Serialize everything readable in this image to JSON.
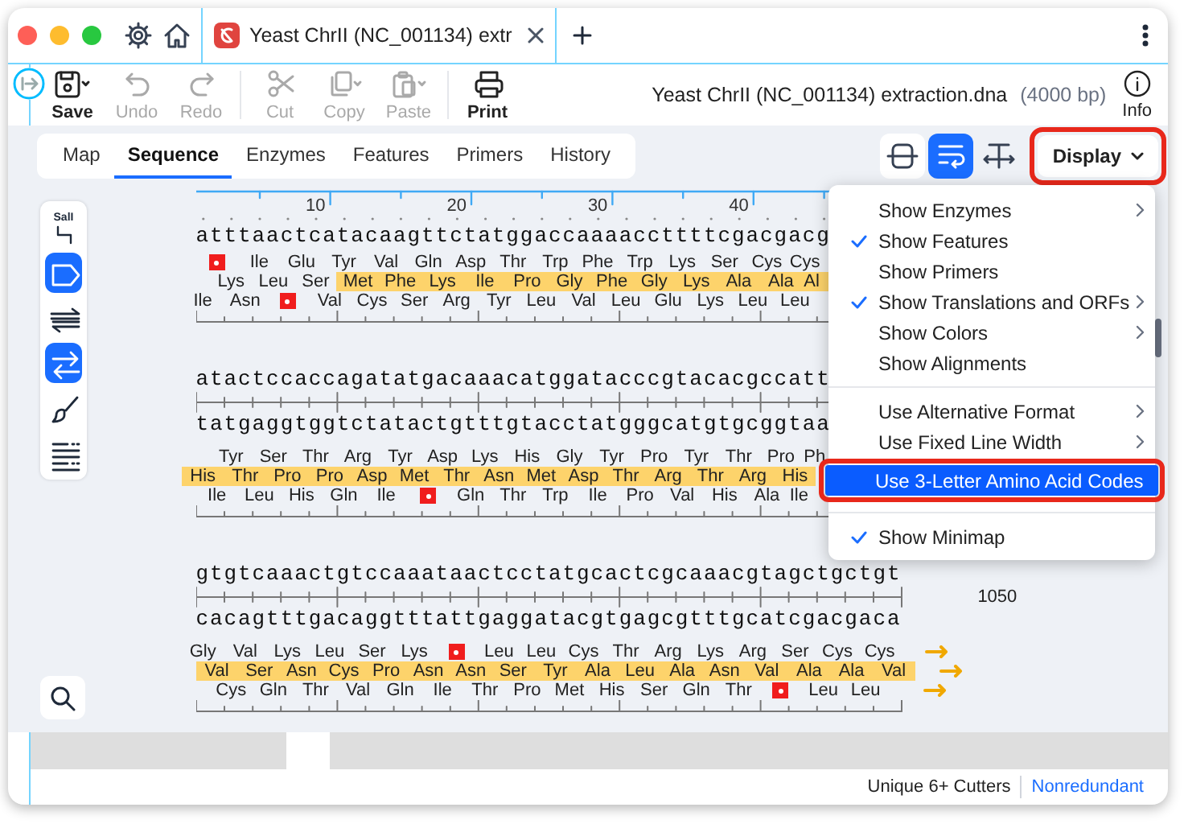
{
  "tab": {
    "title": "Yeast ChrII (NC_001134) extr",
    "selected": true
  },
  "toolbar": [
    [
      {
        "kind": "save",
        "label": "Save",
        "disabled": false
      },
      {
        "kind": "undo",
        "label": "Undo",
        "disabled": true
      },
      {
        "kind": "redo",
        "label": "Redo",
        "disabled": true
      }
    ],
    [
      {
        "kind": "cut",
        "label": "Cut",
        "disabled": true
      },
      {
        "kind": "copy",
        "label": "Copy",
        "disabled": true
      },
      {
        "kind": "paste",
        "label": "Paste",
        "disabled": true
      }
    ],
    [
      {
        "kind": "print",
        "label": "Print",
        "disabled": false
      }
    ]
  ],
  "document": {
    "title": "Yeast ChrII (NC_001134) extraction.dna",
    "length": "(4000 bp)"
  },
  "info": {
    "label": "Info"
  },
  "view_tabs": [
    {
      "label": "Map",
      "selected": false
    },
    {
      "label": "Sequence",
      "selected": true
    },
    {
      "label": "Enzymes",
      "selected": false
    },
    {
      "label": "Features",
      "selected": false
    },
    {
      "label": "Primers",
      "selected": false
    },
    {
      "label": "History",
      "selected": false
    }
  ],
  "view_buttons": [
    {
      "kind": "minimap",
      "selected": false
    },
    {
      "kind": "wrap",
      "selected": true
    },
    {
      "kind": "fit",
      "selected": false
    }
  ],
  "display_button": {
    "label": "Display",
    "highlighted": true
  },
  "display_menu": {
    "groups": [
      {
        "items": [
          {
            "label": "Show Enzymes",
            "checked": false,
            "submenu": true,
            "selected": false,
            "highlighted": false
          },
          {
            "label": "Show Features",
            "checked": true,
            "submenu": false,
            "selected": false,
            "highlighted": false
          },
          {
            "label": "Show Primers",
            "checked": false,
            "submenu": false,
            "selected": false,
            "highlighted": false
          },
          {
            "label": "Show Translations and ORFs",
            "checked": true,
            "submenu": true,
            "selected": false,
            "highlighted": false
          },
          {
            "label": "Show Colors",
            "checked": false,
            "submenu": true,
            "selected": false,
            "highlighted": false
          },
          {
            "label": "Show Alignments",
            "checked": false,
            "submenu": false,
            "selected": false,
            "highlighted": false
          }
        ]
      },
      {
        "items": [
          {
            "label": "Use Alternative Format",
            "checked": false,
            "submenu": true,
            "selected": false,
            "highlighted": false
          },
          {
            "label": "Use Fixed Line Width",
            "checked": false,
            "submenu": true,
            "selected": false,
            "highlighted": false
          },
          {
            "label": "Use 3-Letter Amino Acid Codes",
            "checked": false,
            "submenu": false,
            "selected": true,
            "highlighted": true
          }
        ]
      },
      {
        "items": [
          {
            "label": "Show Minimap",
            "checked": true,
            "submenu": false,
            "selected": false,
            "highlighted": false
          }
        ]
      }
    ]
  },
  "tools": [
    {
      "kind": "enzyme",
      "label": "SalI",
      "selected": false
    },
    {
      "kind": "feature",
      "selected": true
    },
    {
      "kind": "strands",
      "selected": false
    },
    {
      "kind": "translate",
      "selected": true
    },
    {
      "kind": "brush",
      "selected": false
    },
    {
      "kind": "list",
      "selected": false
    }
  ],
  "sequence": {
    "blocks": [
      {
        "ruler": [
          "10",
          "20",
          "30",
          "40"
        ],
        "forward": "atttaactcatacaagttctatggaccaaaaccttttcgacgacg",
        "translations": [
          {
            "segments": [
              {
                "highlighted": false,
                "codons": [
                  {
                    "kind": "stop"
                  },
                  "Ile",
                  "Glu",
                  "Tyr",
                  "Val",
                  "Gln",
                  "Asp",
                  "Thr",
                  "Trp",
                  "Phe",
                  "Trp",
                  "Lys",
                  "Ser",
                  "Cys",
                  "Cys"
                ]
              }
            ]
          },
          {
            "segments": [
              {
                "highlighted": false,
                "codons": [
                  "Lys",
                  "Leu",
                  "Ser"
                ]
              },
              {
                "highlighted": true,
                "codons": [
                  "Met",
                  "Phe",
                  "Lys",
                  "Ile",
                  "Pro",
                  "Gly",
                  "Phe",
                  "Gly",
                  "Lys",
                  "Ala",
                  "Ala",
                  "Al"
                ]
              }
            ]
          },
          {
            "segments": [
              {
                "highlighted": false,
                "codons": [
                  "Ile",
                  "Asn",
                  {
                    "kind": "stop"
                  },
                  "Val",
                  "Cys",
                  "Ser",
                  "Arg",
                  "Tyr",
                  "Leu",
                  "Val",
                  "Leu",
                  "Glu",
                  "Lys",
                  "Leu",
                  "Leu"
                ]
              }
            ]
          }
        ]
      },
      {
        "forward": "atactccaccagatatgacaaacatggatacccgtacacgccatt",
        "complement": "tatgaggtggtctatactgtttgtacctatgggcatgtgcggtaa",
        "translations": [
          {
            "segments": [
              {
                "highlighted": false,
                "codons": [
                  "Tyr",
                  "Ser",
                  "Thr",
                  "Arg",
                  "Tyr",
                  "Asp",
                  "Lys",
                  "His",
                  "Gly",
                  "Tyr",
                  "Pro",
                  "Tyr",
                  "Thr",
                  "Pro",
                  "Ph"
                ]
              }
            ]
          },
          {
            "segments": [
              {
                "highlighted": true,
                "codons": [
                  "His",
                  "Thr",
                  "Pro",
                  "Pro",
                  "Asp",
                  "Met",
                  "Thr",
                  "Asn",
                  "Met",
                  "Asp",
                  "Thr",
                  "Arg",
                  "Thr",
                  "Arg",
                  "His"
                ]
              }
            ]
          },
          {
            "segments": [
              {
                "highlighted": false,
                "codons": [
                  "Ile",
                  "Leu",
                  "His",
                  "Gln",
                  "Ile",
                  {
                    "kind": "stop"
                  },
                  "Gln",
                  "Thr",
                  "Trp",
                  "Ile",
                  "Pro",
                  "Val",
                  "His",
                  "Ala",
                  "Ile"
                ]
              }
            ]
          }
        ]
      },
      {
        "forward": "gtgtcaaactgtccaaataactcctatgcactcgcaaacgtagctgctgt",
        "complement": "cacagtttgacaggtttattgaggatacgtgagcgtttgcatcgacgaca",
        "end_label": "1050",
        "translations": [
          {
            "continues": true,
            "segments": [
              {
                "highlighted": false,
                "codons": [
                  "Gly",
                  "Val",
                  "Lys",
                  "Leu",
                  "Ser",
                  "Lys",
                  {
                    "kind": "stop"
                  },
                  "Leu",
                  "Leu",
                  "Cys",
                  "Thr",
                  "Arg",
                  "Lys",
                  "Arg",
                  "Ser",
                  "Cys",
                  "Cys"
                ]
              }
            ]
          },
          {
            "continues": true,
            "segments": [
              {
                "highlighted": true,
                "codons": [
                  "Val",
                  "Ser",
                  "Asn",
                  "Cys",
                  "Pro",
                  "Asn",
                  "Asn",
                  "Ser",
                  "Tyr",
                  "Ala",
                  "Leu",
                  "Ala",
                  "Asn",
                  "Val",
                  "Ala",
                  "Ala",
                  "Val"
                ]
              }
            ]
          },
          {
            "continues": true,
            "segments": [
              {
                "highlighted": false,
                "codons": [
                  "Cys",
                  "Gln",
                  "Thr",
                  "Val",
                  "Gln",
                  "Ile",
                  "Thr",
                  "Pro",
                  "Met",
                  "His",
                  "Ser",
                  "Gln",
                  "Thr",
                  {
                    "kind": "stop"
                  },
                  "Leu",
                  "Leu"
                ]
              }
            ]
          }
        ]
      }
    ]
  },
  "status_bar": {
    "enzyme_set": "Unique 6+ Cutters",
    "filter_link": "Nonredundant"
  }
}
